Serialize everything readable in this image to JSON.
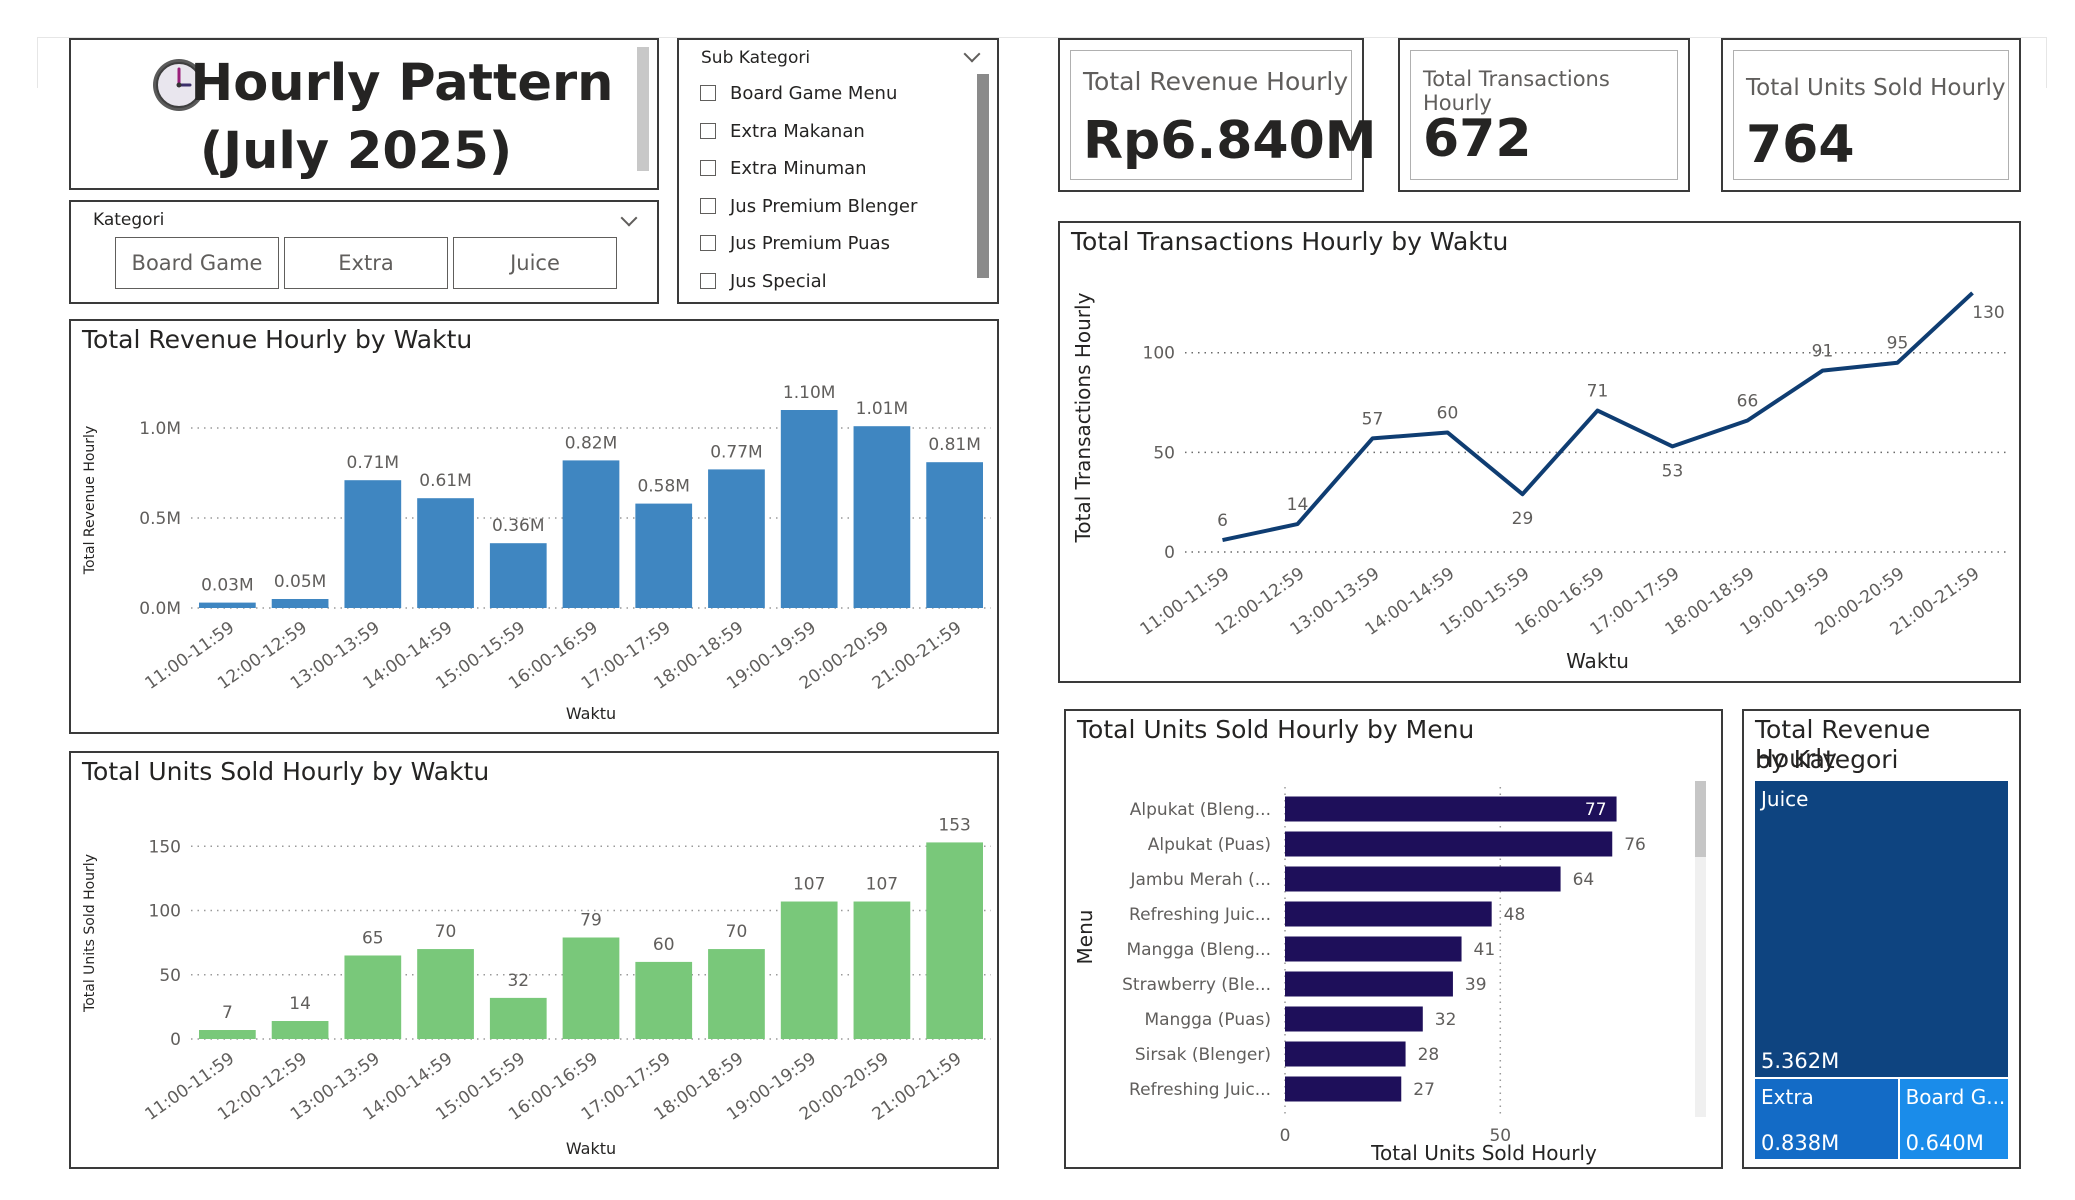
{
  "dashboard": {
    "title_line1": "Hourly Pattern",
    "title_line2": "(July 2025)",
    "clock_icon": "clock-icon"
  },
  "kategori_slicer": {
    "label": "Kategori",
    "options": [
      "Board Game",
      "Extra",
      "Juice"
    ]
  },
  "subkategori_slicer": {
    "label": "Sub Kategori",
    "items": [
      "Board Game Menu",
      "Extra Makanan",
      "Extra Minuman",
      "Jus Premium Blenger",
      "Jus Premium Puas",
      "Jus Special"
    ]
  },
  "cards": {
    "revenue": {
      "label": "Total Revenue Hourly",
      "value": "Rp6.840M"
    },
    "transactions": {
      "label": "Total Transactions Hourly",
      "value": "672"
    },
    "units": {
      "label": "Total Units Sold Hourly",
      "value": "764"
    }
  },
  "colors": {
    "revenue_bar": "#3f86c1",
    "units_bar": "#79c87a",
    "transactions_line": "#0f3d72",
    "menu_bar": "#1e0f5a",
    "treemap_juice": "#0e4480",
    "treemap_extra": "#136bc6",
    "treemap_boardgame": "#1a8cea"
  },
  "chart_data": [
    {
      "id": "revenue",
      "type": "bar",
      "title": "Total Revenue Hourly by Waktu",
      "xlabel": "Waktu",
      "ylabel": "Total Revenue Hourly",
      "categories": [
        "11:00-11:59",
        "12:00-12:59",
        "13:00-13:59",
        "14:00-14:59",
        "15:00-15:59",
        "16:00-16:59",
        "17:00-17:59",
        "18:00-18:59",
        "19:00-19:59",
        "20:00-20:59",
        "21:00-21:59"
      ],
      "values": [
        0.03,
        0.05,
        0.71,
        0.61,
        0.36,
        0.82,
        0.58,
        0.77,
        1.1,
        1.01,
        0.81
      ],
      "data_labels": [
        "0.03M",
        "0.05M",
        "0.71M",
        "0.61M",
        "0.36M",
        "0.82M",
        "0.58M",
        "0.77M",
        "1.10M",
        "1.01M",
        "0.81M"
      ],
      "yticks": [
        0,
        0.5,
        1.0
      ],
      "ytick_labels": [
        "0.0M",
        "0.5M",
        "1.0M"
      ],
      "ylim": [
        0,
        1.2
      ],
      "grid": true
    },
    {
      "id": "units",
      "type": "bar",
      "title": "Total Units Sold Hourly by Waktu",
      "xlabel": "Waktu",
      "ylabel": "Total Units Sold Hourly",
      "categories": [
        "11:00-11:59",
        "12:00-12:59",
        "13:00-13:59",
        "14:00-14:59",
        "15:00-15:59",
        "16:00-16:59",
        "17:00-17:59",
        "18:00-18:59",
        "19:00-19:59",
        "20:00-20:59",
        "21:00-21:59"
      ],
      "values": [
        7,
        14,
        65,
        70,
        32,
        79,
        60,
        70,
        107,
        107,
        153
      ],
      "data_labels": [
        "7",
        "14",
        "65",
        "70",
        "32",
        "79",
        "60",
        "70",
        "107",
        "107",
        "153"
      ],
      "yticks": [
        0,
        50,
        100,
        150
      ],
      "ytick_labels": [
        "0",
        "50",
        "100",
        "150"
      ],
      "ylim": [
        0,
        165
      ],
      "grid": true
    },
    {
      "id": "transactions",
      "type": "line",
      "title": "Total Transactions Hourly by Waktu",
      "xlabel": "Waktu",
      "ylabel": "Total Transactions Hourly",
      "categories": [
        "11:00-11:59",
        "12:00-12:59",
        "13:00-13:59",
        "14:00-14:59",
        "15:00-15:59",
        "16:00-16:59",
        "17:00-17:59",
        "18:00-18:59",
        "19:00-19:59",
        "20:00-20:59",
        "21:00-21:59"
      ],
      "values": [
        6,
        14,
        57,
        60,
        29,
        71,
        53,
        66,
        91,
        95,
        130
      ],
      "data_labels": [
        "6",
        "14",
        "57",
        "60",
        "29",
        "71",
        "53",
        "66",
        "91",
        "95",
        "130"
      ],
      "yticks": [
        0,
        50,
        100
      ],
      "ytick_labels": [
        "0",
        "50",
        "100"
      ],
      "ylim": [
        0,
        135
      ],
      "grid": true
    },
    {
      "id": "menu",
      "type": "bar",
      "orientation": "horizontal",
      "title": "Total Units Sold Hourly by Menu",
      "xlabel": "Total Units Sold Hourly",
      "ylabel": "Menu",
      "categories": [
        "Alpukat (Bleng...",
        "Alpukat (Puas)",
        "Jambu Merah (...",
        "Refreshing Juic...",
        "Mangga (Bleng...",
        "Strawberry (Ble...",
        "Mangga (Puas)",
        "Sirsak (Blenger)",
        "Refreshing Juic..."
      ],
      "values": [
        77,
        76,
        64,
        48,
        41,
        39,
        32,
        28,
        27
      ],
      "data_labels": [
        "77",
        "76",
        "64",
        "48",
        "41",
        "39",
        "32",
        "28",
        "27"
      ],
      "xticks": [
        0,
        50
      ],
      "xtick_labels": [
        "0",
        "50"
      ],
      "xlim": [
        0,
        85
      ],
      "grid": true
    },
    {
      "id": "kategori",
      "type": "treemap",
      "title_line1": "Total Revenue Hourly",
      "title_line2": "by Kategori",
      "items": [
        {
          "name": "Juice",
          "value": 5.362,
          "label": "5.362M"
        },
        {
          "name": "Extra",
          "value": 0.838,
          "label": "0.838M"
        },
        {
          "name": "Board G...",
          "value": 0.64,
          "label": "0.640M"
        }
      ]
    }
  ]
}
